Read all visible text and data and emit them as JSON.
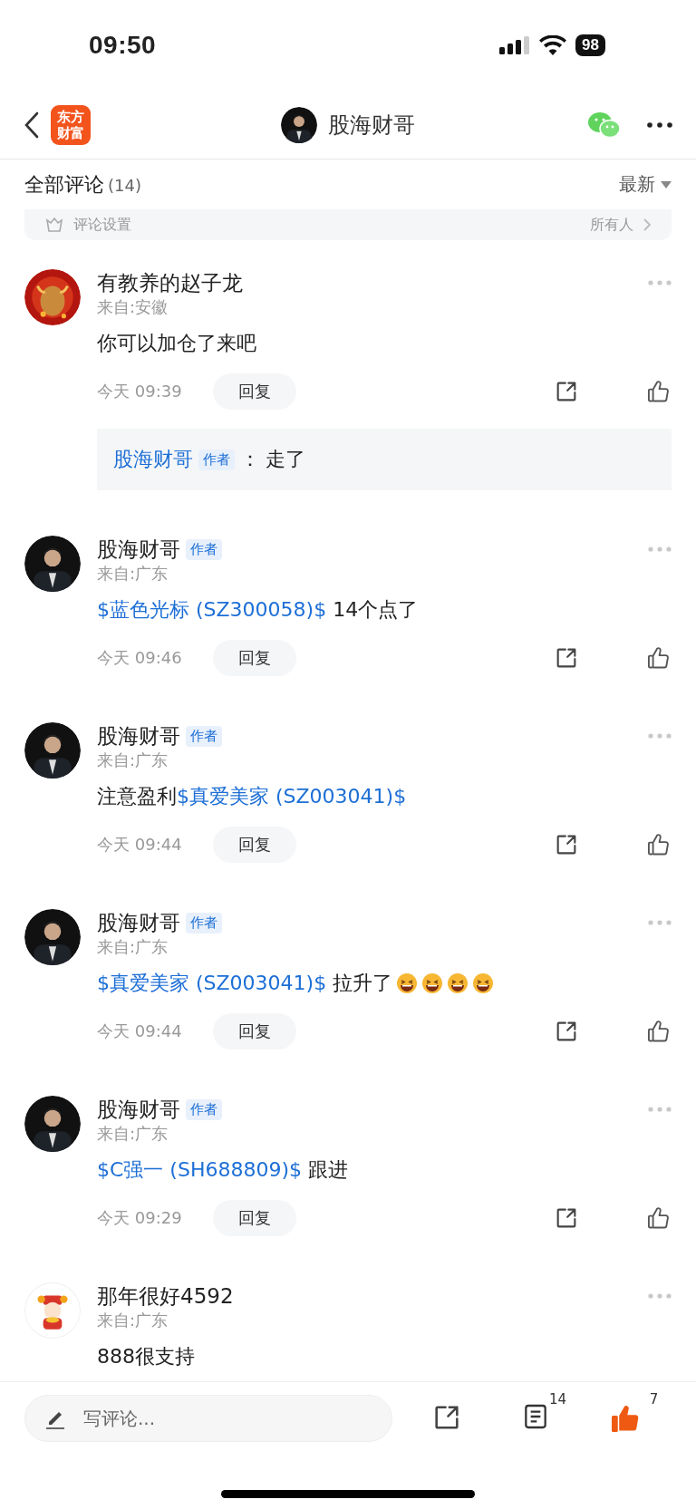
{
  "status_bar": {
    "time": "09:50",
    "battery": "98"
  },
  "nav": {
    "logo_lines": [
      "东方",
      "财富"
    ],
    "title": "股海财哥",
    "avatar": {
      "kind": "suit"
    }
  },
  "header": {
    "title": "全部评论",
    "count": "(14)",
    "sort": "最新"
  },
  "settings_row": {
    "label": "评论设置",
    "value": "所有人"
  },
  "comments": [
    {
      "user": "有教养的赵子龙",
      "avatar": {
        "kind": "bull"
      },
      "location": "来自:安徽",
      "content": [
        {
          "kind": "text",
          "text": "你可以加仓了来吧"
        }
      ],
      "time": "今天 09:39",
      "reply_label": "回复",
      "replies": [
        {
          "user": "股海财哥",
          "badge": "作者",
          "separator": "：",
          "text": "走了"
        }
      ]
    },
    {
      "user": "股海财哥",
      "badge": "作者",
      "avatar": {
        "kind": "suit"
      },
      "location": "来自:广东",
      "content": [
        {
          "kind": "stock",
          "text": "$蓝色光标 (SZ300058)$"
        },
        {
          "kind": "text",
          "text": " 14个点了"
        }
      ],
      "time": "今天 09:46",
      "reply_label": "回复"
    },
    {
      "user": "股海财哥",
      "badge": "作者",
      "avatar": {
        "kind": "suit"
      },
      "location": "来自:广东",
      "content": [
        {
          "kind": "text",
          "text": "注意盈利"
        },
        {
          "kind": "stock",
          "text": "$真爱美家 (SZ003041)$"
        }
      ],
      "time": "今天 09:44",
      "reply_label": "回复"
    },
    {
      "user": "股海财哥",
      "badge": "作者",
      "avatar": {
        "kind": "suit"
      },
      "location": "来自:广东",
      "content": [
        {
          "kind": "stock",
          "text": "$真爱美家 (SZ003041)$"
        },
        {
          "kind": "text",
          "text": " 拉升了"
        },
        {
          "kind": "emoji"
        },
        {
          "kind": "emoji"
        },
        {
          "kind": "emoji"
        },
        {
          "kind": "emoji"
        }
      ],
      "time": "今天 09:44",
      "reply_label": "回复"
    },
    {
      "user": "股海财哥",
      "badge": "作者",
      "avatar": {
        "kind": "suit"
      },
      "location": "来自:广东",
      "content": [
        {
          "kind": "stock",
          "text": "$C强一 (SH688809)$"
        },
        {
          "kind": "text",
          "text": " 跟进"
        }
      ],
      "time": "今天 09:29",
      "reply_label": "回复"
    },
    {
      "user": "那年很好4592",
      "avatar": {
        "kind": "cartoon"
      },
      "location": "来自:广东",
      "content": [
        {
          "kind": "text",
          "text": "888很支持"
        }
      ]
    }
  ],
  "bottom_bar": {
    "placeholder": "写评论...",
    "comment_count": "14",
    "like_count": "7",
    "liked": true
  }
}
